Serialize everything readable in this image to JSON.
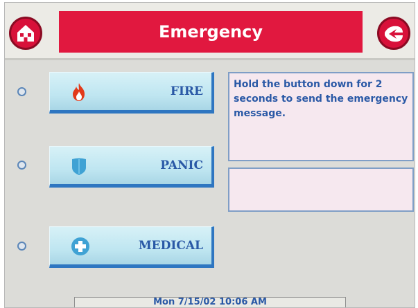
{
  "header": {
    "title": "Emergency",
    "home_icon": "home-icon",
    "back_icon": "back-arrow-icon",
    "accent_color": "#e1183f"
  },
  "buttons": [
    {
      "label": "FIRE",
      "icon": "fire-icon"
    },
    {
      "label": "PANIC",
      "icon": "shield-icon"
    },
    {
      "label": "MEDICAL",
      "icon": "medical-cross-icon"
    }
  ],
  "message": {
    "text": "Hold the button down for 2 seconds to send the emergency message."
  },
  "input": {
    "value": ""
  },
  "status": {
    "datetime": "Mon 7/15/02 10:06 AM"
  }
}
